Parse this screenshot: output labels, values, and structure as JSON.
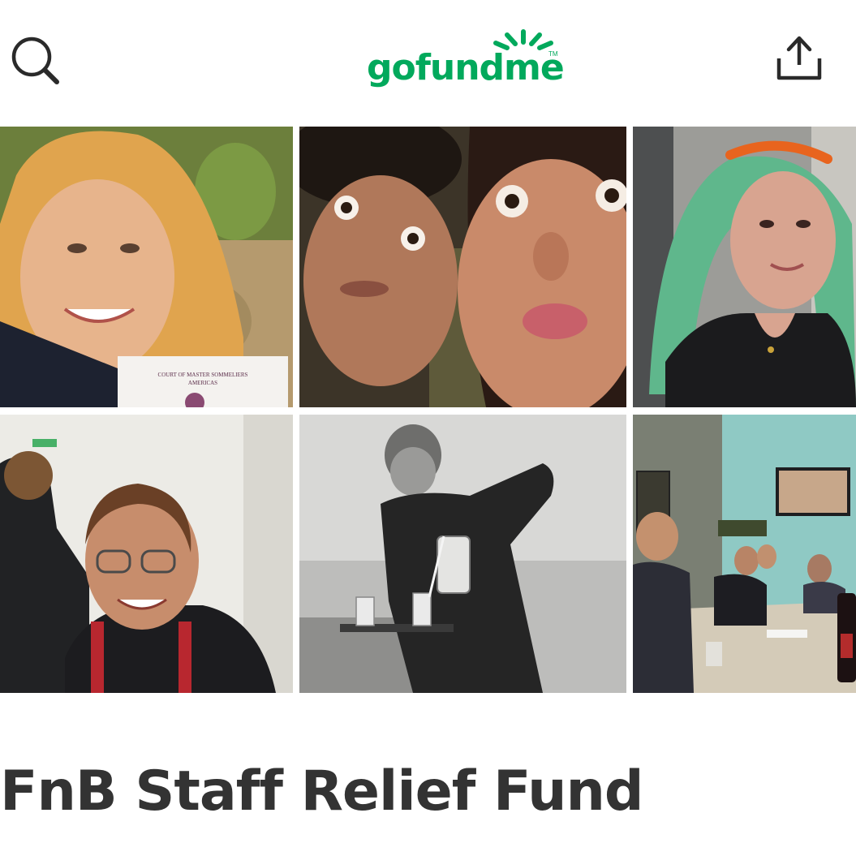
{
  "header": {
    "logo_text": "gofundme",
    "logo_tm": "TM",
    "brand_color": "#02a95c",
    "search_icon": "search-icon",
    "share_icon": "share-icon"
  },
  "photos": [
    {
      "name": "photo-woman-with-certificate",
      "certificate_line1": "COURT OF MASTER SOMMELIERS",
      "certificate_line2": "AMERICAS"
    },
    {
      "name": "photo-couple-selfie"
    },
    {
      "name": "photo-woman-green-wig"
    },
    {
      "name": "photo-chef-smiling"
    },
    {
      "name": "photo-vintage-waiter-pouring"
    },
    {
      "name": "photo-restaurant-dinner-table"
    }
  ],
  "campaign": {
    "title": "FnB Staff Relief Fund"
  }
}
